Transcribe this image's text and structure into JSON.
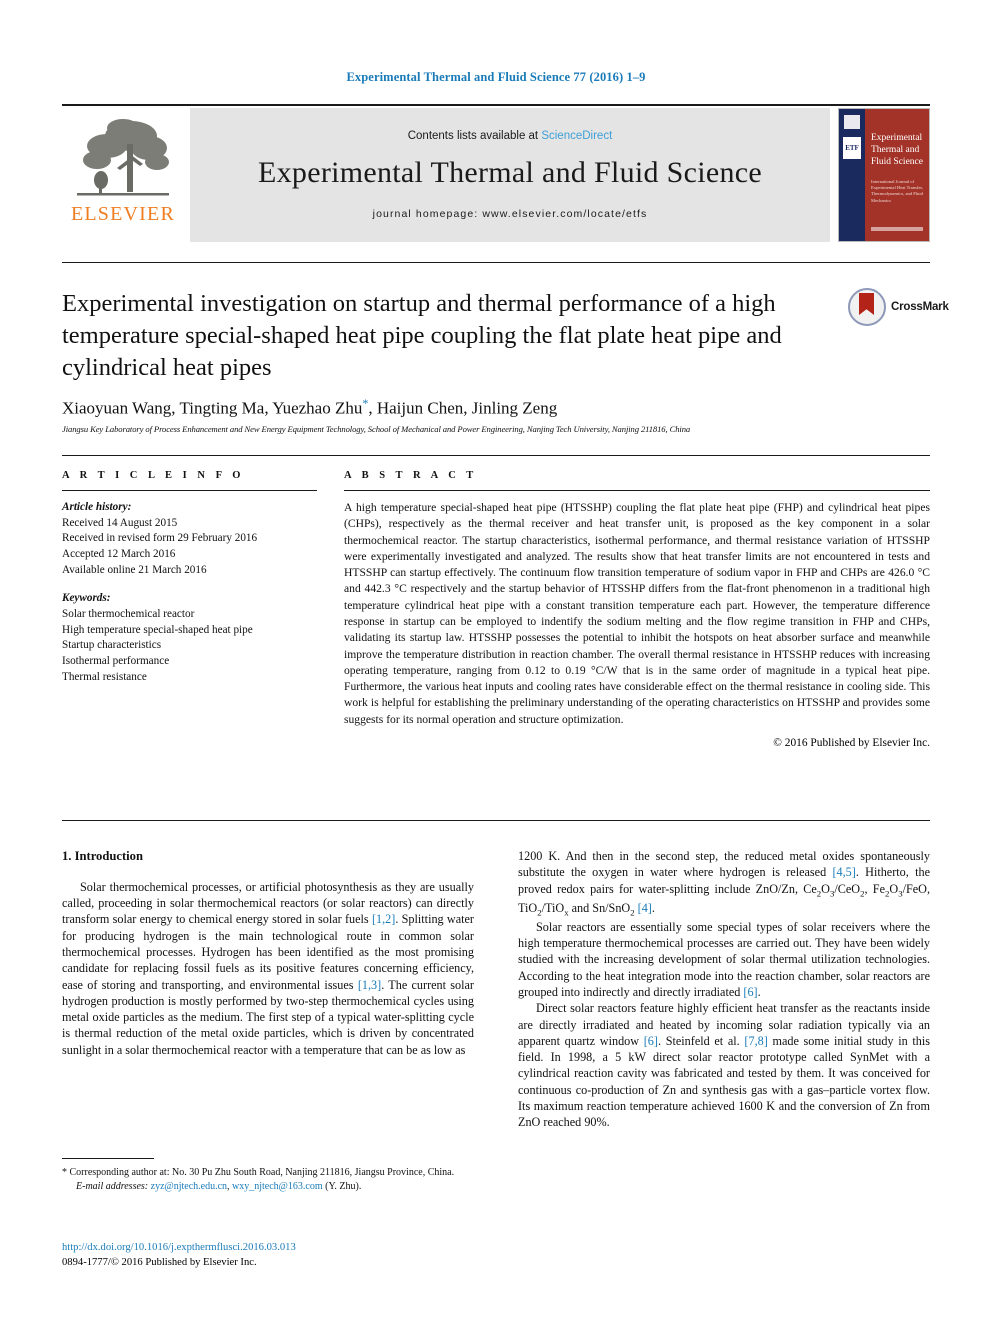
{
  "running_head": "Experimental Thermal and Fluid Science 77 (2016) 1–9",
  "masthead": {
    "publisher_name": "ELSEVIER",
    "contents_prefix": "Contents lists available at",
    "contents_link": "ScienceDirect",
    "journal_name": "Experimental Thermal and Fluid Science",
    "homepage": "journal homepage: www.elsevier.com/locate/etfs",
    "cover": {
      "title": "Experimental Thermal and Fluid Science",
      "subtitle": "International Journal of Experimental Heat Transfer, Thermodynamics, and Fluid Mechanics",
      "logo_text": "ETF"
    }
  },
  "article": {
    "title": "Experimental investigation on startup and thermal performance of a high temperature special-shaped heat pipe coupling the flat plate heat pipe and cylindrical heat pipes",
    "crossmark_label": "CrossMark",
    "authors": "Xiaoyuan Wang, Tingting Ma, Yuezhao Zhu",
    "authors_tail": ", Haijun Chen, Jinling Zeng",
    "corresponding_marker": "*",
    "affiliation": "Jiangsu Key Laboratory of Process Enhancement and New Energy Equipment Technology, School of Mechanical and Power Engineering, Nanjing Tech University, Nanjing 211816, China"
  },
  "article_info": {
    "heading": "A R T I C L E   I N F O",
    "history_label": "Article history:",
    "history": [
      "Received 14 August 2015",
      "Received in revised form 29 February 2016",
      "Accepted 12 March 2016",
      "Available online 21 March 2016"
    ],
    "keywords_label": "Keywords:",
    "keywords": [
      "Solar thermochemical reactor",
      "High temperature special-shaped heat pipe",
      "Startup characteristics",
      "Isothermal performance",
      "Thermal resistance"
    ]
  },
  "abstract": {
    "heading": "A B S T R A C T",
    "text": "A high temperature special-shaped heat pipe (HTSSHP) coupling the flat plate heat pipe (FHP) and cylindrical heat pipes (CHPs), respectively as the thermal receiver and heat transfer unit, is proposed as the key component in a solar thermochemical reactor. The startup characteristics, isothermal performance, and thermal resistance variation of HTSSHP were experimentally investigated and analyzed. The results show that heat transfer limits are not encountered in tests and HTSSHP can startup effectively. The continuum flow transition temperature of sodium vapor in FHP and CHPs are 426.0 °C and 442.3 °C respectively and the startup behavior of HTSSHP differs from the flat-front phenomenon in a traditional high temperature cylindrical heat pipe with a constant transition temperature each part. However, the temperature difference response in startup can be employed to indentify the sodium melting and the flow regime transition in FHP and CHPs, validating its startup law. HTSSHP possesses the potential to inhibit the hotspots on heat absorber surface and meanwhile improve the temperature distribution in reaction chamber. The overall thermal resistance in HTSSHP reduces with increasing operating temperature, ranging from 0.12 to 0.19 °C/W that is in the same order of magnitude in a typical heat pipe. Furthermore, the various heat inputs and cooling rates have considerable effect on the thermal resistance in cooling side. This work is helpful for establishing the preliminary understanding of the operating characteristics on HTSSHP and provides some suggests for its normal operation and structure optimization.",
    "copyright": "© 2016 Published by Elsevier Inc."
  },
  "introduction": {
    "heading": "1. Introduction",
    "left_paragraph_1_a": "Solar thermochemical processes, or artificial photosynthesis as they are usually called, proceeding in solar thermochemical reactors (or solar reactors) can directly transform solar energy to chemical energy stored in solar fuels ",
    "left_ref_1": "[1,2]",
    "left_paragraph_1_b": ". Splitting water for producing hydrogen is the main technological route in common solar thermochemical processes. Hydrogen has been identified as the most promising candidate for replacing fossil fuels as its positive features concerning efficiency, ease of storing and transporting, and environmental issues ",
    "left_ref_2": "[1,3]",
    "left_paragraph_1_c": ". The current solar hydrogen production is mostly performed by two-step thermochemical cycles using metal oxide particles as the medium. The first step of a typical water-splitting cycle is thermal reduction of the metal oxide particles, which is driven by concentrated sunlight in a solar thermochemical reactor with a temperature that can be as low as",
    "right_paragraph_1_a": "1200 K. And then in the second step, the reduced metal oxides spontaneously substitute the oxygen in water where hydrogen is released ",
    "right_ref_1": "[4,5]",
    "right_paragraph_1_b": ". Hitherto, the proved redox pairs for water-splitting include ZnO/Zn, Ce",
    "right_formula_1": "Ce2O3/CeO2, Fe2O3/FeO, TiO2/TiOx and Sn/SnO2",
    "right_ref_2": "[4]",
    "right_paragraph_2_a": "Solar reactors are essentially some special types of solar receivers where the high temperature thermochemical processes are carried out. They have been widely studied with the increasing development of solar thermal utilization technologies. According to the heat integration mode into the reaction chamber, solar reactors are grouped into indirectly and directly irradiated ",
    "right_ref_3": "[6]",
    "right_paragraph_3_a": "Direct solar reactors feature highly efficient heat transfer as the reactants inside are directly irradiated and heated by incoming solar radiation typically via an apparent quartz window ",
    "right_ref_4": "[6]",
    "right_paragraph_3_b": ". Steinfeld et al. ",
    "right_ref_5": "[7,8]",
    "right_paragraph_3_c": " made some initial study in this field. In 1998, a 5 kW direct solar reactor prototype called SynMet with a cylindrical reaction cavity was fabricated and tested by them. It was conceived for continuous co-production of Zn and synthesis gas with a gas–particle vortex flow. Its maximum reaction temperature achieved 1600 K and the conversion of Zn from ZnO reached 90%."
  },
  "footnotes": {
    "corresponding_star": "*",
    "corresponding_text": " Corresponding author at: No. 30 Pu Zhu South Road, Nanjing 211816, Jiangsu Province, China.",
    "email_label": "E-mail addresses:",
    "email_1": "zyz@njtech.edu.cn",
    "email_2": "wxy_njtech@163.com",
    "email_suffix": " (Y. Zhu).",
    "doi": "http://dx.doi.org/10.1016/j.expthermflusci.2016.03.013",
    "issn_line": "0894-1777/© 2016 Published by Elsevier Inc."
  },
  "colors": {
    "link": "#1a7bb9",
    "elsevier_orange": "#ef7d22",
    "cover_red": "#a33328",
    "cover_navy": "#1b2a5e",
    "band_gray": "#e4e4e4"
  }
}
